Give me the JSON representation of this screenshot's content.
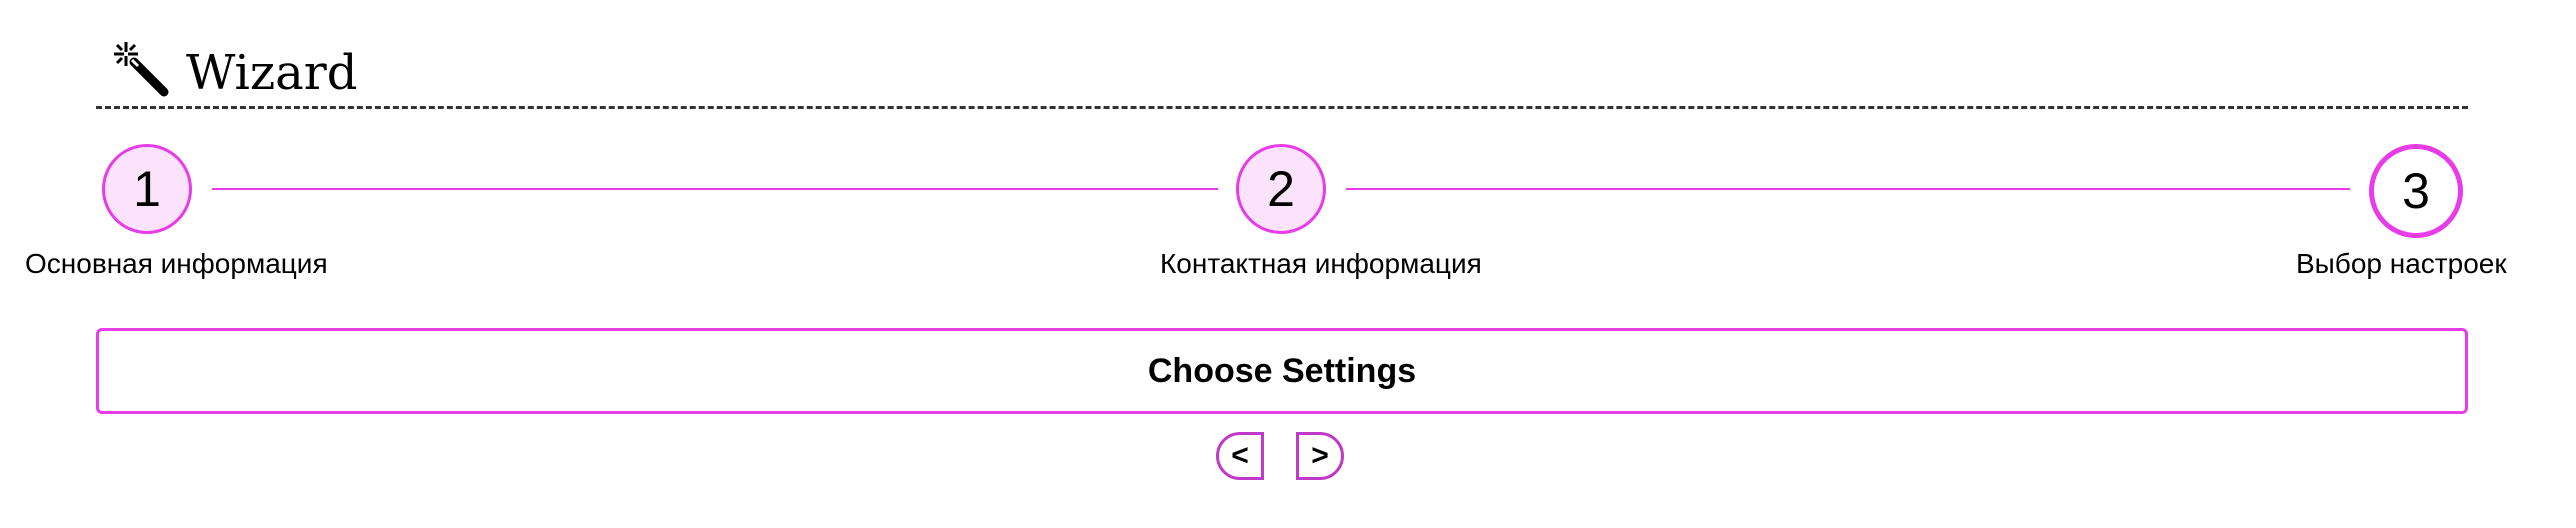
{
  "header": {
    "icon": "magic-wand-icon",
    "title": "Wizard"
  },
  "steps": [
    {
      "number": "1",
      "label": "Основная информация"
    },
    {
      "number": "2",
      "label": "Контактная информация"
    },
    {
      "number": "3",
      "label": "Выбор настроек"
    }
  ],
  "active_step": 3,
  "panel": {
    "heading": "Choose Settings"
  },
  "nav": {
    "prev_label": "<",
    "next_label": ">"
  },
  "colors": {
    "accent": "#e93ce9",
    "step_fill": "#fbe4fb",
    "nav_border": "#c03ac8"
  }
}
